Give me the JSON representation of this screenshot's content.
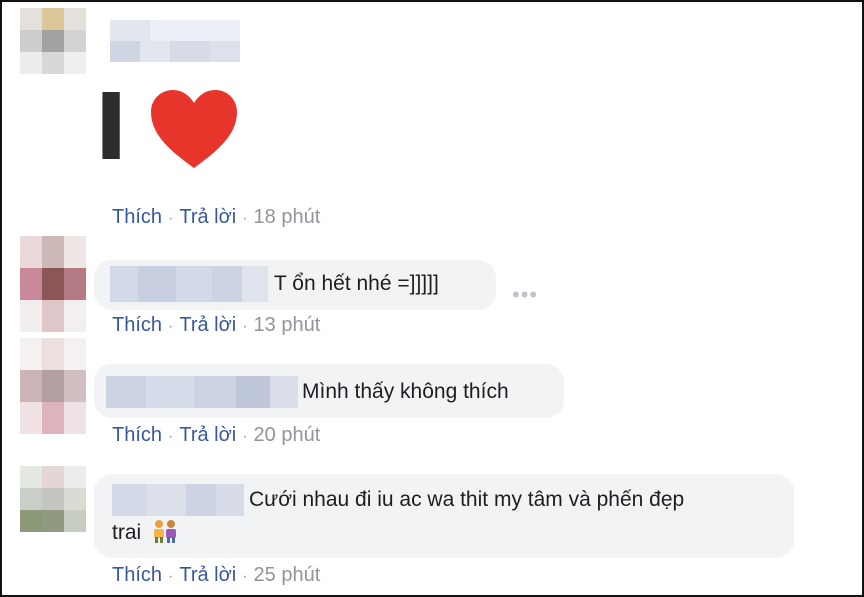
{
  "comments": [
    {
      "sticker": {
        "letter": "I",
        "icon": "red-heart-icon"
      },
      "actions": {
        "like": "Thích",
        "reply": "Trả lời",
        "time": "18 phút"
      }
    },
    {
      "text": "T ổn hết nhé =]]]]]",
      "prefix": "T",
      "actions": {
        "like": "Thích",
        "reply": "Trả lời",
        "time": "13 phút"
      }
    },
    {
      "text": "Mình thấy không thích",
      "actions": {
        "like": "Thích",
        "reply": "Trả lời",
        "time": "20 phút"
      }
    },
    {
      "text_line1": "Cưới nhau đi iu ac wa thit my tâm và phến đẹp",
      "text_line2": "trai",
      "emoji": "couple-icon",
      "actions": {
        "like": "Thích",
        "reply": "Trả lời",
        "time": "25 phút"
      }
    }
  ],
  "separator": "·",
  "colors": {
    "link": "#385898",
    "meta": "#90949c",
    "bubble": "#f2f3f5",
    "heart": "#e8352c"
  }
}
